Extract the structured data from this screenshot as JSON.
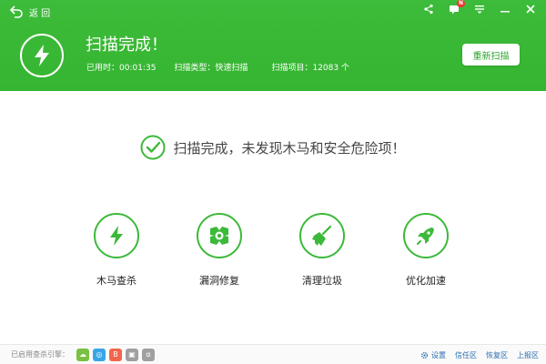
{
  "header": {
    "back_label": "返 回",
    "badge_count": "N",
    "title": "扫描完成！",
    "stats": {
      "elapsed": "已用时：00:01:35",
      "scan_type": "扫描类型：快速扫描",
      "items": "扫描项目：12083 个"
    },
    "rescan_label": "重新扫描",
    "colors": {
      "header_green": "#35b531",
      "accent_green": "#3cb93a"
    }
  },
  "result": {
    "message": "扫描完成，未发现木马和安全危险项！",
    "icon": "check-circle-icon"
  },
  "features": [
    {
      "label": "木马查杀",
      "icon": "lightning-icon"
    },
    {
      "label": "漏洞修复",
      "icon": "patch-icon"
    },
    {
      "label": "清理垃圾",
      "icon": "broom-icon"
    },
    {
      "label": "优化加速",
      "icon": "rocket-icon"
    }
  ],
  "footer": {
    "engines_label": "已启用查杀引擎：",
    "engines": [
      {
        "icon": "cloud-engine-icon",
        "color": "#7ac143"
      },
      {
        "icon": "qvm-engine-icon",
        "color": "#37a6e6"
      },
      {
        "icon": "bitdefender-engine-icon",
        "color": "#f0664b"
      },
      {
        "icon": "system-repair-engine-icon",
        "color": "#999999"
      },
      {
        "icon": "avira-engine-icon",
        "color": "#999999"
      }
    ],
    "links": {
      "settings": "设置",
      "trust": "信任区",
      "restore": "恢复区",
      "report": "上报区"
    }
  }
}
